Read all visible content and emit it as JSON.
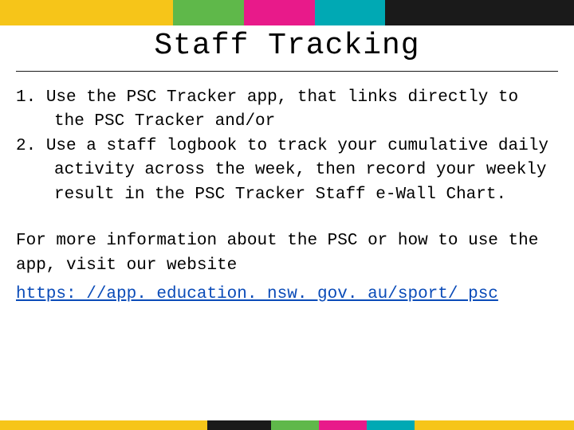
{
  "title": "Staff Tracking",
  "list": {
    "items": [
      "Use the PSC Tracker app, that links directly to the PSC Tracker and/or",
      "Use a staff logbook to track your cumulative daily activity across the week, then record your weekly result in the PSC Tracker Staff e-Wall Chart."
    ]
  },
  "info_text": "For more information about the PSC or how to use the app, visit our website",
  "link_text": "https: //app. education. nsw. gov. au/sport/ psc"
}
